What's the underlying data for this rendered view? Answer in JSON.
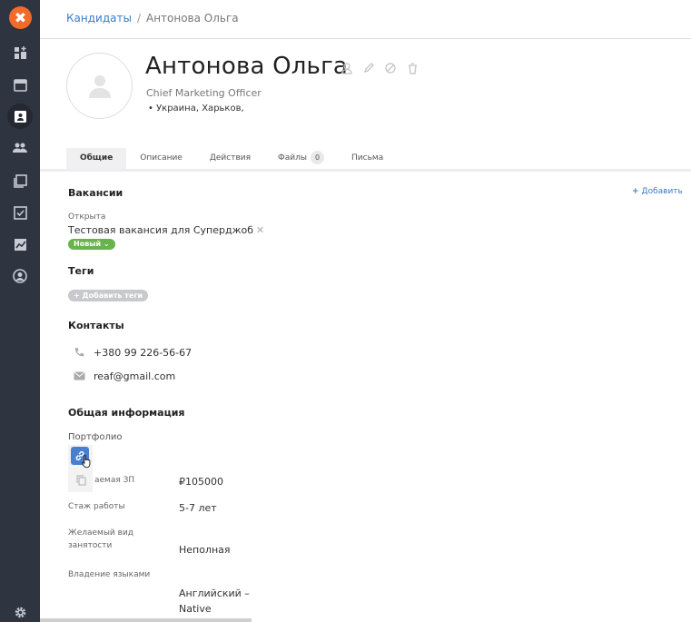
{
  "sidebar": {
    "logo": "✖",
    "icons": [
      "dashboard-icon",
      "calendar-icon",
      "candidates-icon",
      "team-icon",
      "library-icon",
      "tasks-icon",
      "analytics-icon",
      "account-icon",
      "settings-icon"
    ],
    "active": "candidates-icon"
  },
  "breadcrumb": {
    "parent": "Кандидаты",
    "separator": "/",
    "current": "Антонова Ольга"
  },
  "profile": {
    "name": "Антонова Ольга",
    "position": "Chief Marketing Officer",
    "location": "• Украина, Харьков,"
  },
  "tabs": [
    {
      "label": "Общие",
      "active": true
    },
    {
      "label": "Описание"
    },
    {
      "label": "Действия"
    },
    {
      "label": "Файлы",
      "badge": "0"
    },
    {
      "label": "Письма"
    }
  ],
  "vacancies": {
    "title": "Вакансии",
    "add_label": "Добавить",
    "state_label": "Открыта",
    "vacancy_name": "Тестовая вакансия для Суперджоб",
    "status": "Новый"
  },
  "tags": {
    "title": "Теги",
    "add_label": "Добавить теги"
  },
  "contacts": {
    "title": "Контакты",
    "phone": "+380 99 226-56-67",
    "email": "reaf@gmail.com"
  },
  "info": {
    "title": "Общая информация",
    "portfolio_label": "Портфолио",
    "salary_label": "аемая ЗП",
    "salary_value": "₽105000",
    "experience_label": "Стаж работы",
    "experience_value": "5-7 лет",
    "employment_label_1": "Желаемый вид",
    "employment_label_2": "занятости",
    "employment_value": "Неполная",
    "languages_label": "Владение языками",
    "languages_value_1": "Английский –",
    "languages_value_2": "Native"
  },
  "colors": {
    "accent": "#3a7bc8",
    "sidebar": "#2e3440",
    "logo": "#f26b2a",
    "status_green": "#67b44a"
  }
}
